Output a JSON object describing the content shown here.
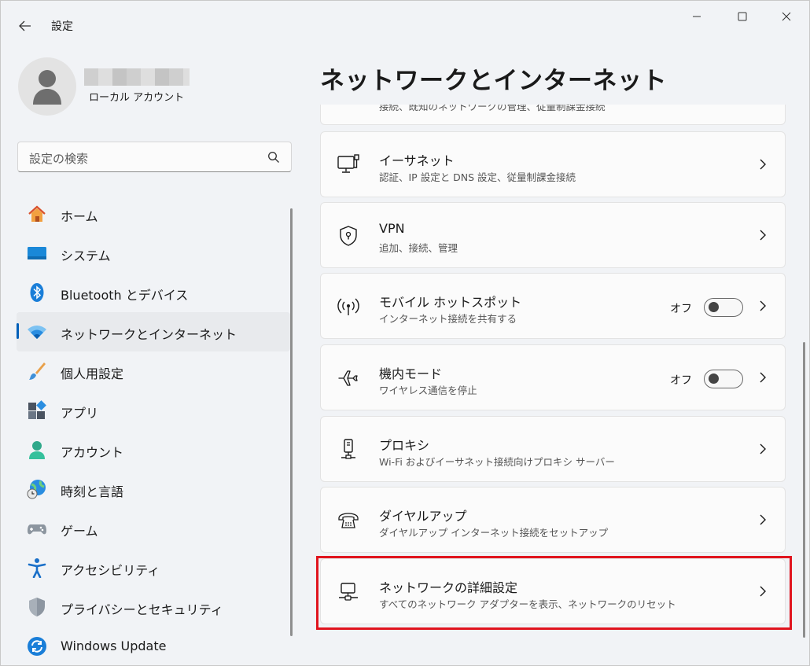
{
  "window": {
    "title": "設定",
    "controls": [
      "minimize",
      "maximize",
      "close"
    ]
  },
  "profile": {
    "name": "",
    "account_type": "ローカル アカウント"
  },
  "search": {
    "placeholder": "設定の検索"
  },
  "nav": {
    "items": [
      {
        "label": "ホーム",
        "icon": "home-icon",
        "selected": false
      },
      {
        "label": "システム",
        "icon": "system-icon",
        "selected": false
      },
      {
        "label": "Bluetooth とデバイス",
        "icon": "bluetooth-icon",
        "selected": false
      },
      {
        "label": "ネットワークとインターネット",
        "icon": "wifi-icon",
        "selected": true
      },
      {
        "label": "個人用設定",
        "icon": "brush-icon",
        "selected": false
      },
      {
        "label": "アプリ",
        "icon": "apps-icon",
        "selected": false
      },
      {
        "label": "アカウント",
        "icon": "account-icon",
        "selected": false
      },
      {
        "label": "時刻と言語",
        "icon": "globe-clock-icon",
        "selected": false
      },
      {
        "label": "ゲーム",
        "icon": "gamepad-icon",
        "selected": false
      },
      {
        "label": "アクセシビリティ",
        "icon": "accessibility-icon",
        "selected": false
      },
      {
        "label": "プライバシーとセキュリティ",
        "icon": "shield-icon",
        "selected": false
      },
      {
        "label": "Windows Update",
        "icon": "windows-update-icon",
        "selected": false
      }
    ]
  },
  "main": {
    "title": "ネットワークとインターネット",
    "partial_card": {
      "subtitle": "接続、既知のネットワークの管理、従量制課金接続"
    },
    "cards": [
      {
        "title": "イーサネット",
        "subtitle": "認証、IP 設定と DNS 設定、従量制課金接続",
        "icon": "ethernet-icon"
      },
      {
        "title": "VPN",
        "subtitle": "追加、接続、管理",
        "icon": "vpn-shield-icon"
      },
      {
        "title": "モバイル ホットスポット",
        "subtitle": "インターネット接続を共有する",
        "icon": "hotspot-icon",
        "toggle_label": "オフ",
        "toggle_on": false
      },
      {
        "title": "機内モード",
        "subtitle": "ワイヤレス通信を停止",
        "icon": "airplane-icon",
        "toggle_label": "オフ",
        "toggle_on": false
      },
      {
        "title": "プロキシ",
        "subtitle": "Wi-Fi およびイーサネット接続向けプロキシ サーバー",
        "icon": "proxy-icon"
      },
      {
        "title": "ダイヤルアップ",
        "subtitle": "ダイヤルアップ インターネット接続をセットアップ",
        "icon": "dialup-icon"
      },
      {
        "title": "ネットワークの詳細設定",
        "subtitle": "すべてのネットワーク アダプターを表示、ネットワークのリセット",
        "icon": "network-pc-icon",
        "highlighted": true
      }
    ]
  },
  "colors": {
    "accent": "#005fb8",
    "highlight": "#e0141e",
    "background": "#f1f3f6",
    "card": "#fbfbfb"
  }
}
